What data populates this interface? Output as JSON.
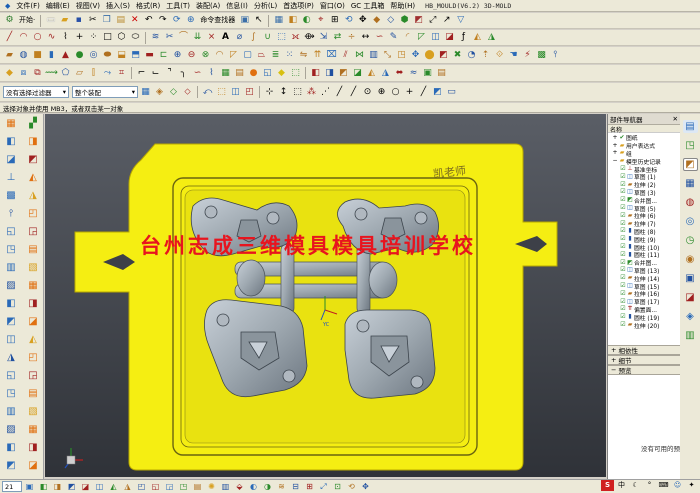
{
  "menu": {
    "items": [
      "文件(F)",
      "编辑(E)",
      "视图(V)",
      "插入(S)",
      "格式(R)",
      "工具(T)",
      "装配(A)",
      "信息(I)",
      "分析(L)",
      "首选项(P)",
      "窗口(O)",
      "GC 工具箱",
      "帮助(H)"
    ],
    "window_title": "HB_MOULD(V6.2)  3D-MOLD"
  },
  "toolbar1": {
    "start_label": "开始·",
    "command_finder_label": "命令查找器"
  },
  "selection": {
    "filter_label": "没有选择过滤器",
    "assembly_label": "整个装配"
  },
  "cue_line": "选择对象并使用 MB3，或者双击某一对象",
  "viewport": {
    "watermark_text": "台州志成三维模具模具培训学校",
    "signature_text": "凯老师",
    "coord_label": "YC",
    "colors": {
      "plate": "#f5ee12",
      "part": "#9ea8b0",
      "background": "#3d4048"
    }
  },
  "part_navigator": {
    "title": "部件导航器",
    "column_header": "名称",
    "nodes": [
      {
        "label": "图纸",
        "icon": "checked-folder-icon"
      },
      {
        "label": "用户表达式",
        "icon": "folder-icon"
      },
      {
        "label": "组",
        "icon": "folder-icon"
      },
      {
        "label": "模型历史记录",
        "icon": "folder-icon"
      },
      {
        "label": "基准坐标",
        "icon": "datum-icon"
      },
      {
        "label": "草图 (1)",
        "icon": "sketch-icon"
      },
      {
        "label": "拉伸 (2)",
        "icon": "extrude-icon"
      },
      {
        "label": "草图 (3)",
        "icon": "sketch-icon"
      },
      {
        "label": "合并图...",
        "icon": "merge-icon"
      },
      {
        "label": "草图 (5)",
        "icon": "sketch-icon"
      },
      {
        "label": "拉伸 (6)",
        "icon": "extrude-icon"
      },
      {
        "label": "拉伸 (7)",
        "icon": "extrude-icon"
      },
      {
        "label": "圆柱 (8)",
        "icon": "cylinder-icon"
      },
      {
        "label": "圆柱 (9)",
        "icon": "cylinder-icon"
      },
      {
        "label": "圆柱 (10)",
        "icon": "cylinder-icon"
      },
      {
        "label": "圆柱 (11)",
        "icon": "cylinder-icon"
      },
      {
        "label": "合并图...",
        "icon": "merge-icon"
      },
      {
        "label": "草图 (13)",
        "icon": "sketch-icon"
      },
      {
        "label": "拉伸 (14)",
        "icon": "extrude-icon"
      },
      {
        "label": "草图 (15)",
        "icon": "sketch-icon"
      },
      {
        "label": "拉伸 (16)",
        "icon": "extrude-icon"
      },
      {
        "label": "草图 (17)",
        "icon": "sketch-icon"
      },
      {
        "label": "偏置面...",
        "icon": "offset-icon"
      },
      {
        "label": "圆柱 (19)",
        "icon": "cylinder-icon"
      },
      {
        "label": "拉伸 (20)",
        "icon": "extrude-icon"
      }
    ],
    "sections": [
      "相依性",
      "细节",
      "预览"
    ],
    "preview_empty": "没有可用的预"
  }
}
